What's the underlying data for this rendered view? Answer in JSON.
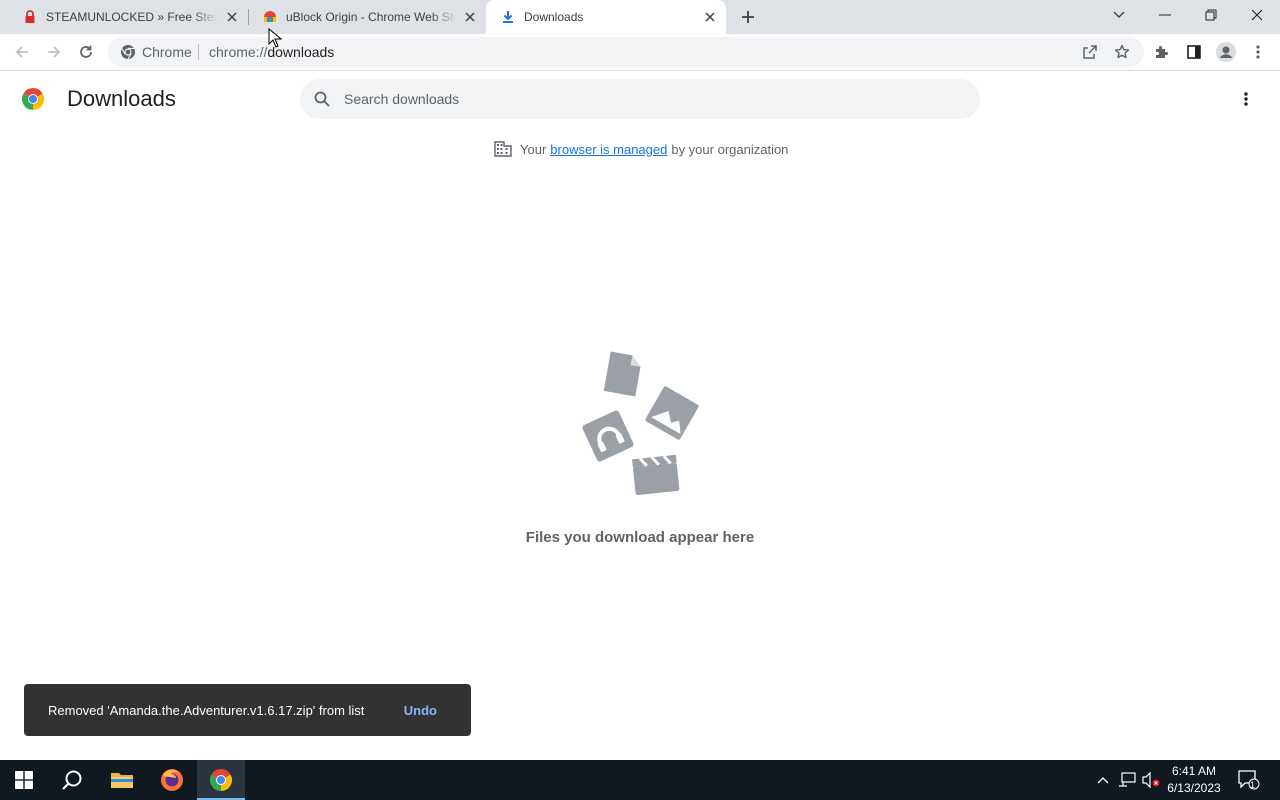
{
  "window": {
    "tabs": [
      {
        "title": "STEAMUNLOCKED » Free Steam Games Pre-installed for PC",
        "favicon": "steamunlocked-lock-icon",
        "active": false
      },
      {
        "title": "uBlock Origin - Chrome Web Store",
        "favicon": "chrome-web-store-icon",
        "active": false
      },
      {
        "title": "Downloads",
        "favicon": "download-icon",
        "active": true
      }
    ],
    "controls": [
      "tab-search-icon",
      "minimize-icon",
      "restore-icon",
      "close-icon"
    ]
  },
  "toolbar": {
    "site_chip": "Chrome",
    "url_scheme": "chrome://",
    "url_host": "downloads"
  },
  "page": {
    "title": "Downloads",
    "search_placeholder": "Search downloads",
    "managed_prefix": "Your",
    "managed_link": "browser is managed",
    "managed_suffix": "by your organization",
    "empty_message": "Files you download appear here"
  },
  "toast": {
    "message": "Removed 'Amanda.the.Adventurer.v1.6.17.zip' from list",
    "action": "Undo"
  },
  "taskbar": {
    "time": "6:41 AM",
    "date": "6/13/2023",
    "notification_count": "1"
  },
  "colors": {
    "accent": "#1a73e8",
    "tabstrip": "#dee1e6",
    "taskbar": "#101820",
    "toast": "#323232"
  }
}
